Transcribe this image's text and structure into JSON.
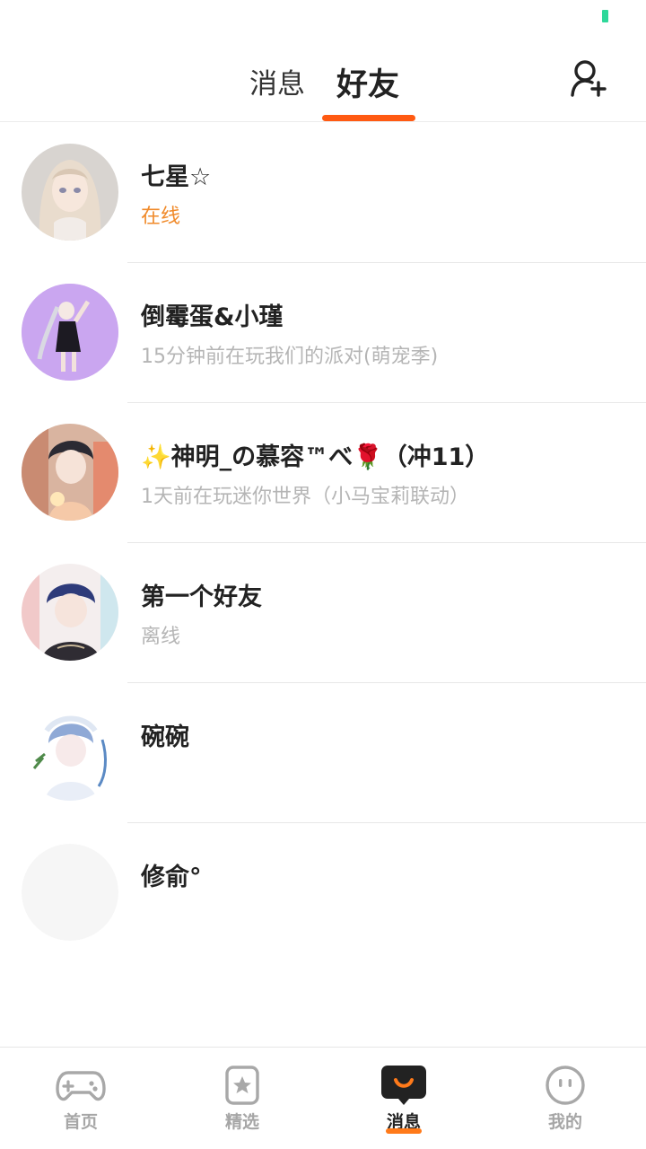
{
  "header": {
    "tabs": [
      {
        "label": "消息",
        "active": false
      },
      {
        "label": "好友",
        "active": true
      }
    ],
    "add_friend_icon": "add-user-icon",
    "accent_color": "#ff5a12"
  },
  "friends": [
    {
      "name": "七星☆",
      "status": "在线",
      "online": true
    },
    {
      "name": "倒霉蛋&小瑾",
      "status": "15分钟前在玩我们的派对(萌宠季)",
      "online": false
    },
    {
      "name": "✨神明_の慕容™べ🌹（冲11）",
      "status": "1天前在玩迷你世界（小马宝莉联动）",
      "online": false
    },
    {
      "name": "第一个好友",
      "status": "离线",
      "online": false
    },
    {
      "name": "碗碗",
      "status": "",
      "online": false
    },
    {
      "name": "修俞°",
      "status": "",
      "online": false
    }
  ],
  "bottom_nav": [
    {
      "label": "首页",
      "icon": "gamepad-icon",
      "active": false
    },
    {
      "label": "精选",
      "icon": "star-bookmark-icon",
      "active": false
    },
    {
      "label": "消息",
      "icon": "chat-bubble-icon",
      "active": true
    },
    {
      "label": "我的",
      "icon": "face-icon",
      "active": false
    }
  ],
  "colors": {
    "accent": "#ff5a12",
    "online_status": "#f08a2a",
    "muted_text": "#b5b5b5",
    "status_indicator": "#2fd89a"
  }
}
